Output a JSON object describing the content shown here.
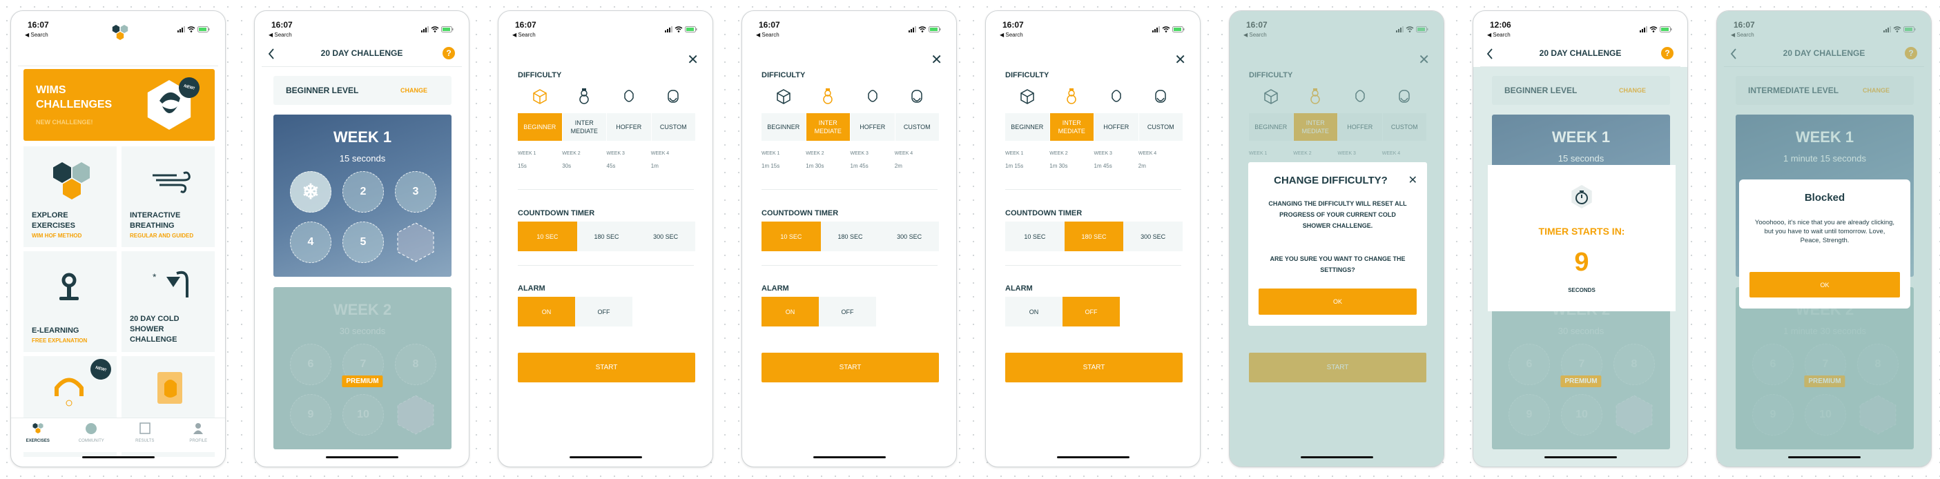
{
  "colors": {
    "accent": "#f5a207",
    "dark": "#1f3d45",
    "tile": "#f3f7f7"
  },
  "screens": [
    {
      "type": "home",
      "status": {
        "time": "16:07",
        "back": "Search"
      },
      "hero": {
        "line1": "WIMS",
        "line2": "CHALLENGES",
        "subtitle": "NEW CHALLENGE!",
        "badge": "NEW!"
      },
      "tiles": [
        {
          "lines": [
            "EXPLORE",
            "EXERCISES"
          ],
          "subtitle": "WIM HOF METHOD",
          "icon": "hexagons-icon"
        },
        {
          "lines": [
            "INTERACTIVE",
            "BREATHING"
          ],
          "subtitle": "REGULAR AND GUIDED",
          "icon": "wind-icon"
        },
        {
          "lines": [
            "E-LEARNING"
          ],
          "subtitle": "FREE EXPLANATION",
          "icon": "meditation-icon"
        },
        {
          "lines": [
            "20 DAY COLD",
            "SHOWER",
            "CHALLENGE"
          ],
          "subtitle": "",
          "icon": "shower-icon"
        },
        {
          "lines": [],
          "subtitle": "",
          "icon": "headphones-icon",
          "badge": "NEW!"
        },
        {
          "lines": [],
          "subtitle": "",
          "icon": "book-icon"
        }
      ],
      "tabs": [
        {
          "label": "EXERCISES",
          "icon": "exercises-icon",
          "active": true
        },
        {
          "label": "COMMUNITY",
          "icon": "globe-icon"
        },
        {
          "label": "RESULTS",
          "icon": "results-icon"
        },
        {
          "label": "PROFILE",
          "icon": "profile-icon"
        }
      ]
    },
    {
      "type": "challenge",
      "status": {
        "time": "16:07",
        "back": "Search"
      },
      "title": "20 DAY CHALLENGE",
      "help": "?",
      "level": "BEGINNER LEVEL",
      "change": "CHANGE",
      "weeks": [
        {
          "title": "WEEK 1",
          "duration": "15 seconds",
          "days": [
            "",
            "2",
            "3",
            "4",
            "5",
            ""
          ],
          "completed_days": 1
        },
        {
          "title": "WEEK 2",
          "duration": "30 seconds",
          "days": [
            "6",
            "7",
            "8",
            "9",
            "10",
            ""
          ],
          "premium": "PREMIUM"
        }
      ]
    },
    {
      "type": "settings",
      "status": {
        "time": "16:07",
        "back": "Search"
      },
      "difficulty_label": "DIFFICULTY",
      "difficulties": [
        "BEGINNER",
        "INTER\nMEDIATE",
        "HOFFER",
        "CUSTOM"
      ],
      "difficulty_selected": 0,
      "week_labels": [
        "WEEK 1",
        "WEEK 2",
        "WEEK 3",
        "WEEK 4"
      ],
      "week_values": [
        "15s",
        "30s",
        "45s",
        "1m"
      ],
      "timer_label": "COUNTDOWN TIMER",
      "timers": [
        "10 SEC",
        "180 SEC",
        "300 SEC"
      ],
      "timer_selected": 0,
      "alarm_label": "ALARM",
      "alarms": [
        "ON",
        "OFF"
      ],
      "alarm_selected": 0,
      "start": "START"
    },
    {
      "type": "settings",
      "status": {
        "time": "16:07",
        "back": "Search"
      },
      "difficulty_label": "DIFFICULTY",
      "difficulties": [
        "BEGINNER",
        "INTER\nMEDIATE",
        "HOFFER",
        "CUSTOM"
      ],
      "difficulty_selected": 1,
      "week_labels": [
        "WEEK 1",
        "WEEK 2",
        "WEEK 3",
        "WEEK 4"
      ],
      "week_values": [
        "1m 15s",
        "1m 30s",
        "1m 45s",
        "2m"
      ],
      "timer_label": "COUNTDOWN TIMER",
      "timers": [
        "10 SEC",
        "180 SEC",
        "300 SEC"
      ],
      "timer_selected": 0,
      "alarm_label": "ALARM",
      "alarms": [
        "ON",
        "OFF"
      ],
      "alarm_selected": 0,
      "start": "START"
    },
    {
      "type": "settings",
      "status": {
        "time": "16:07",
        "back": "Search"
      },
      "difficulty_label": "DIFFICULTY",
      "difficulties": [
        "BEGINNER",
        "INTER\nMEDIATE",
        "HOFFER",
        "CUSTOM"
      ],
      "difficulty_selected": 1,
      "week_labels": [
        "WEEK 1",
        "WEEK 2",
        "WEEK 3",
        "WEEK 4"
      ],
      "week_values": [
        "1m 15s",
        "1m 30s",
        "1m 45s",
        "2m"
      ],
      "timer_label": "COUNTDOWN TIMER",
      "timers": [
        "10 SEC",
        "180 SEC",
        "300 SEC"
      ],
      "timer_selected": 1,
      "alarm_label": "ALARM",
      "alarms": [
        "ON",
        "OFF"
      ],
      "alarm_selected": 1,
      "start": "START"
    },
    {
      "type": "settings",
      "status": {
        "time": "16:07",
        "back": "Search"
      },
      "difficulty_label": "DIFFICULTY",
      "difficulties": [
        "BEGINNER",
        "INTER\nMEDIATE",
        "HOFFER",
        "CUSTOM"
      ],
      "difficulty_selected": 1,
      "week_labels": [
        "WEEK 1",
        "WEEK 2",
        "WEEK 3",
        "WEEK 4"
      ],
      "week_values": [],
      "timer_label": "",
      "timers": [],
      "alarm_label": "",
      "alarms": [],
      "start": "START",
      "modal": {
        "title": "CHANGE DIFFICULTY?",
        "body": "CHANGING THE DIFFICULTY WILL RESET ALL PROGRESS OF YOUR CURRENT COLD SHOWER CHALLENGE.",
        "question": "ARE YOU SURE YOU WANT TO CHANGE THE SETTINGS?",
        "ok": "OK"
      }
    },
    {
      "type": "challenge",
      "status": {
        "time": "12:06",
        "back": "Search"
      },
      "title": "20 DAY CHALLENGE",
      "help": "?",
      "level": "BEGINNER LEVEL",
      "change": "CHANGE",
      "weeks": [
        {
          "title": "WEEK 1",
          "duration": "15 seconds",
          "days": []
        },
        {
          "title": "WEEK 2",
          "duration": "30 seconds",
          "days": [
            "6",
            "7",
            "8",
            "9",
            "10",
            ""
          ],
          "premium": "PREMIUM"
        }
      ],
      "timer": {
        "label": "TIMER STARTS IN:",
        "value": "9",
        "unit": "SECONDS"
      }
    },
    {
      "type": "challenge",
      "status": {
        "time": "16:07",
        "back": "Search"
      },
      "title": "20 DAY CHALLENGE",
      "help": "?",
      "level": "INTERMEDIATE LEVEL",
      "change": "CHANGE",
      "weeks": [
        {
          "title": "WEEK 1",
          "duration": "1 minute 15 seconds",
          "days": []
        },
        {
          "title": "WEEK 2",
          "duration": "1 minute 30 seconds",
          "days": [
            "6",
            "7",
            "8",
            "9",
            "10",
            ""
          ],
          "premium": "PREMIUM"
        }
      ],
      "blocked": {
        "title": "Blocked",
        "body": "Yooohooo, it's nice that you are already clicking, but you have to wait until tomorrow. Love, Peace, Strength.",
        "ok": "OK"
      }
    }
  ]
}
